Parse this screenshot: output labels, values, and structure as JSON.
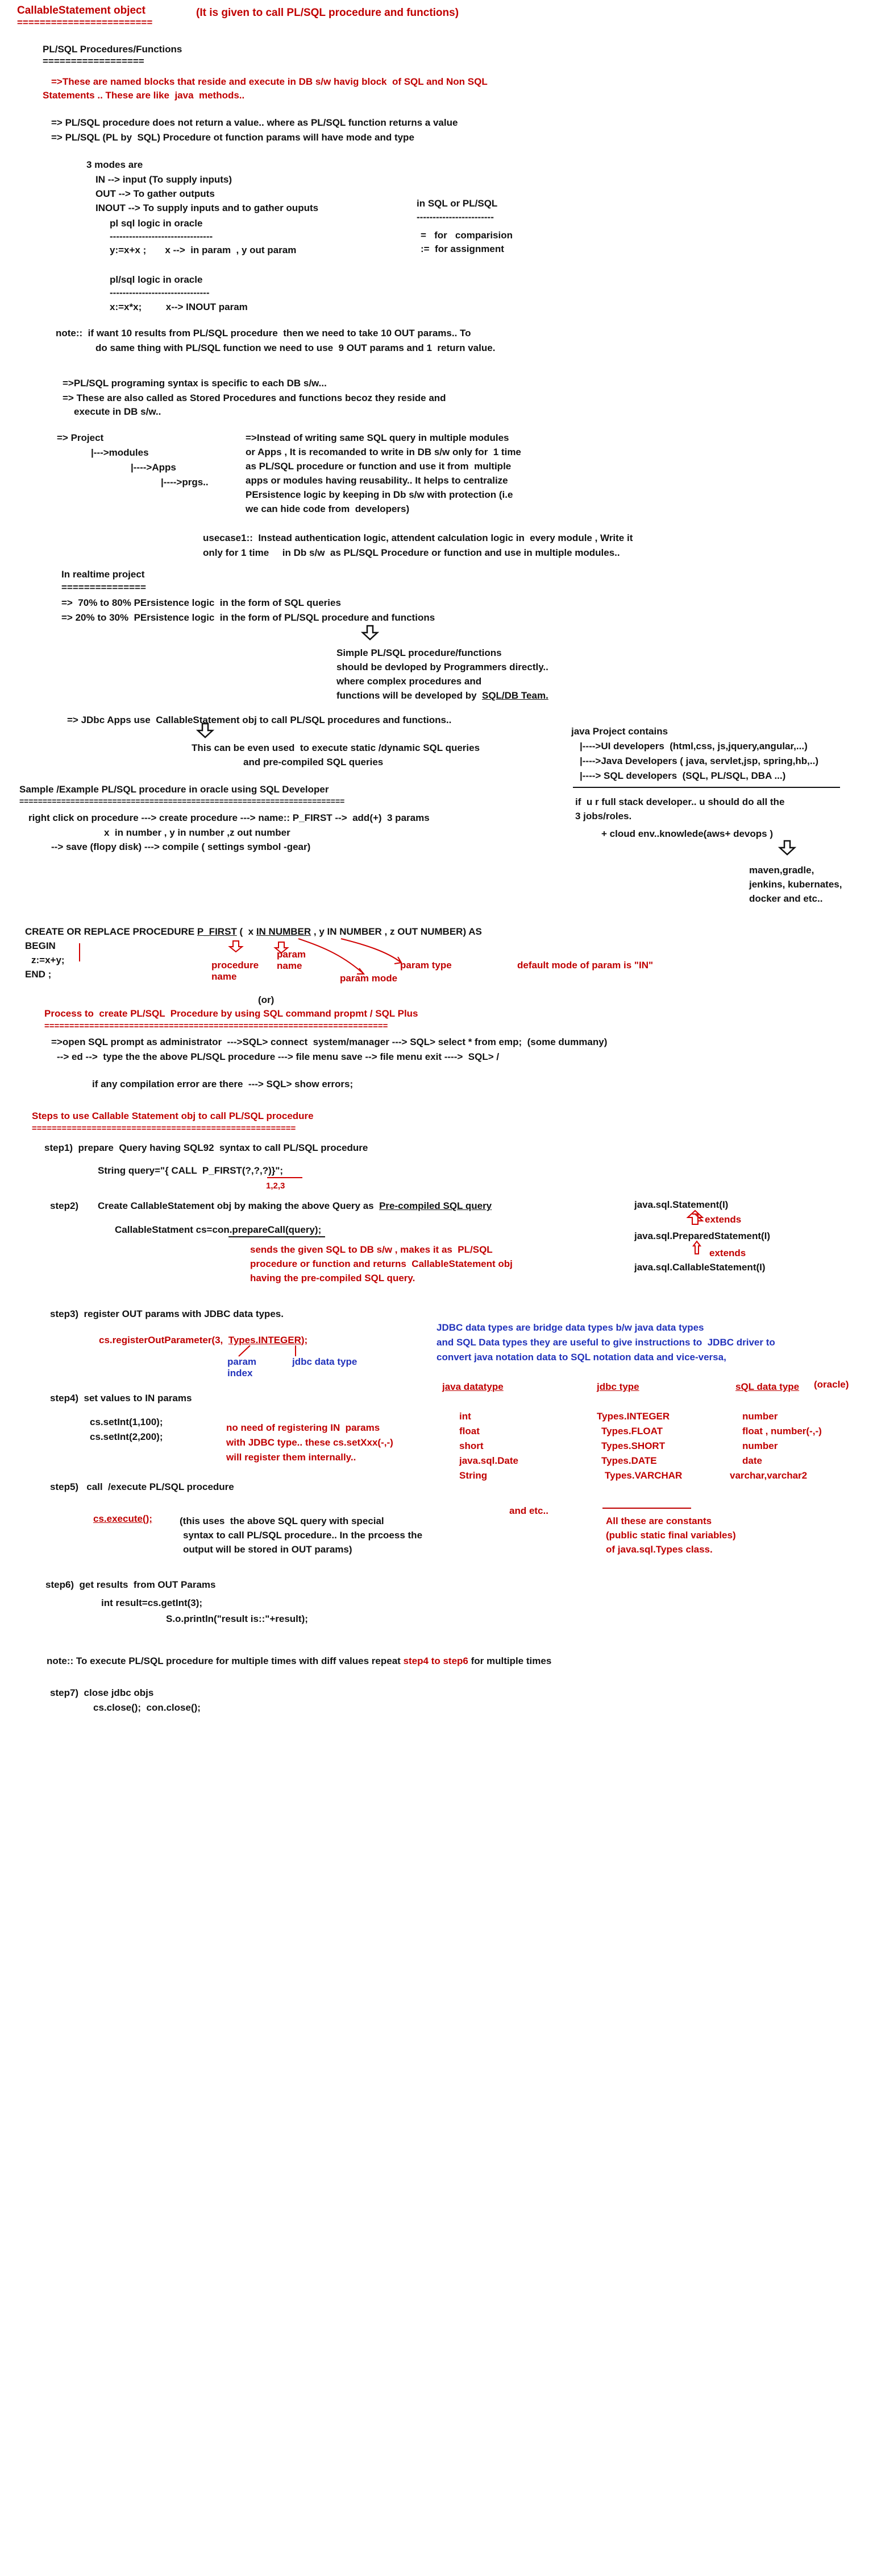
{
  "header": {
    "title": "CallableStatement object",
    "title_underline": "========================",
    "note": "(It is given to call PL/SQL procedure and functions)"
  },
  "intro": {
    "heading": "PL/SQL Procedures/Functions",
    "heading_underline": "==================",
    "red1": "=>These are named blocks that reside and execute in DB s/w havig block  of SQL and Non SQL",
    "red2": "Statements .. These are like  java  methods..",
    "p1": "=> PL/SQL procedure does not return a value.. where as PL/SQL function returns a value",
    "p2": "=> PL/SQL (PL by  SQL) Procedure ot function params will have mode and type",
    "modes": "3 modes are",
    "in": "IN --> input (To supply inputs)",
    "out": "OUT --> To gather outputs",
    "inout": "INOUT --> To supply inputs and to gather ouputs",
    "logic1": "pl sql logic in oracle",
    "dash1": "--------------------------------",
    "eq1": "y:=x+x ;       x -->  in param  , y out param",
    "logic2": "pl/sql logic in oracle",
    "dash2": "-------------------------------",
    "eq2": "x:=x*x;         x--> INOUT param",
    "insql": "in SQL or PL/SQL",
    "dash3": "------------------------",
    "eqc": "=   for   comparision",
    "assign": ":=  for assignment"
  },
  "note1": {
    "l1": "note::  if want 10 results from PL/SQL procedure  then we need to take 10 OUT params.. To",
    "l2": "do same thing with PL/SQL function we need to use  9 OUT params and 1  return value."
  },
  "syntax": {
    "l1": "=>PL/SQL programing syntax is specific to each DB s/w...",
    "l2": "=> These are also called as Stored Procedures and functions becoz they reside and",
    "l3": "execute in DB s/w.."
  },
  "project": {
    "p": "=> Project",
    "m": "|--->modules",
    "a": "|---->Apps",
    "pr": "|---->prgs..",
    "r1": "=>Instead of writing same SQL query in multiple modules",
    "r2": "or Apps , It is recomanded to write in DB s/w only for  1 time",
    "r3": "as PL/SQL procedure or function and use it from  multiple",
    "r4": "apps or modules having reusability.. It helps to centralize",
    "r5": "PErsistence logic by keeping in Db s/w with protection (i.e",
    "r6": "we can hide code from  developers)",
    "u1": "usecase1::  Instead authentication logic, attendent calculation logic in  every module , Write it",
    "u2": "only for 1 time     in Db s/w  as PL/SQL Procedure or function and use in multiple modules.."
  },
  "realtime": {
    "h": "In realtime project",
    "hu": "===============",
    "l1": "=>  70% to 80% PErsistence logic  in the form of SQL queries",
    "l2": "=> 20% to 30%  PErsistence logic  in the form of PL/SQL procedure and functions",
    "s1": "Simple PL/SQL procedure/functions",
    "s2": "should be devloped by Programmers directly..",
    "s3": "where complex procedures and",
    "s4": "functions will be developed by  ",
    "s4u": "SQL/DB Team.",
    "jdbc": "=> JDbc Apps use  CallableStatement obj to call PL/SQL procedures and functions..",
    "c1": "This can be even used  to execute static /dynamic SQL queries",
    "c2": "and pre-compiled SQL queries"
  },
  "javaproj": {
    "h": "java Project contains",
    "l1": "|---->UI developers  (html,css, js,jquery,angular,...)",
    "l2": "|---->Java Developers ( java, servlet,jsp, spring,hb,..)",
    "l3": "|----> SQL developers  (SQL, PL/SQL, DBA ...)",
    "f1": "if  u r full stack developer.. u should do all the",
    "f2": "3 jobs/roles.",
    "f3": "+ cloud env..knowlede(aws+ devops )",
    "m1": "maven,gradle,",
    "m2": "jenkins, kubernates,",
    "m3": "docker and etc.."
  },
  "sample": {
    "h": "Sample /Example PL/SQL procedure in oracle using SQL Developer",
    "hu": "======================================================================",
    "l1": "right click on procedure ---> create procedure ---> name:: P_FIRST -->  add(+)  3 params",
    "l2": "x  in number , y in number ,z out number",
    "l3": "--> save (flopy disk) ---> compile ( settings symbol -gear)"
  },
  "code": {
    "l1a": "CREATE OR REPLACE PROCEDURE ",
    "l1b": "P_FIRST",
    "l1c": " (  x ",
    "l1d": "IN NUMBER",
    "l1e": " , y IN NUMBER , z OUT NUMBER) AS",
    "l2": "BEGIN",
    "l3": "z:=x+y;",
    "l4": "END ;",
    "a_proc": "procedure\nname",
    "a_pname": "param\nname",
    "a_ptype": "param type",
    "a_pmode": "param mode",
    "a_default": "default mode of param is \"IN\""
  },
  "plus": {
    "or": "(or)",
    "h": "Process to  create PL/SQL  Procedure by using SQL command propmt / SQL Plus",
    "hu": "=====================================================================",
    "l1": "=>open SQL prompt as administrator  --->SQL> connect  system/manager ---> SQL> select * from emp;  (some dummany)",
    "l2": "--> ed -->  type the the above PL/SQL procedure ---> file menu save --> file menu exit ---->  SQL> /",
    "l3": "if any compilation error are there  ---> SQL> show errors;"
  },
  "steps": {
    "h": "Steps to use Callable Statement obj to call PL/SQL procedure",
    "hu": "=====================================================",
    "s1": "step1)  prepare  Query having SQL92  syntax to call PL/SQL procedure",
    "s1c": "String query=\"{ CALL  P_FIRST(?,?,?)}\";",
    "s1n": "1,2,3",
    "s2": "step2)",
    "s2t": "Create CallableStatement obj by making the above Query as  ",
    "s2u": "Pre-compiled SQL query",
    "s2c": "CallableStatment cs=con.prepareCall(query);",
    "s2r1": "sends the given SQL to DB s/w , makes it as  PL/SQL",
    "s2r2": "procedure or function and returns  CallableStatement obj",
    "s2r3": "having the pre-compiled SQL query.",
    "i1": "java.sql.Statement(I)",
    "ext1": "extends",
    "i2": "java.sql.PreparedStatement(I)",
    "ext2": "extends",
    "i3": "java.sql.CallableStatement(I)",
    "s3": "step3)  register OUT params with JDBC data types.",
    "s3c1": "cs.registerOutParameter(3,  ",
    "s3c2": "Types.INTEGER",
    "s3c3": ");",
    "pidx": "param\nindex",
    "jdt": "jdbc data type",
    "b1": "JDBC data types are bridge data types b/w java data types",
    "b2": "and SQL Data types they are useful to give instructions to  JDBC driver to",
    "b3": "convert java notation data to SQL notation data and vice-versa,",
    "s4": "step4)  set values to IN params",
    "s4a": "cs.setInt(1,100);",
    "s4b": "cs.setInt(2,200);",
    "s4r1": "no need of registering IN  params",
    "s4r2": "with JDBC type.. these cs.setXxx(-,-)",
    "s4r3": "will register them internally..",
    "s5": "step5)   call  /execute PL/SQL procedure",
    "s5c": "cs.execute();",
    "s5t1": "(this uses  the above SQL query with special",
    "s5t2": "syntax to call PL/SQL procedure.. In the prcoess the",
    "s5t3": "output will be stored in OUT params)",
    "etc": "and etc..",
    "const1": "All these are constants",
    "const2": "(public static final variables)",
    "const3": "of java.sql.Types class.",
    "s6": "step6)  get results  from OUT Params",
    "s6a": "int result=cs.getInt(3);",
    "s6b": "S.o.println(\"result is::\"+result);",
    "note_a": "note:: To execute PL/SQL procedure for multiple times with diff values repeat ",
    "note_b": "step4 to step6",
    "note_c": " for multiple times",
    "s7": "step7)  close jdbc objs",
    "s7a": "cs.close();  con.close();"
  },
  "table": {
    "headers": [
      "java datatype",
      "jdbc type",
      "sQL data type"
    ],
    "oracle": "(oracle)",
    "rows": [
      [
        "int",
        "Types.INTEGER",
        "number"
      ],
      [
        "float",
        "Types.FLOAT",
        "float , number(-,-)"
      ],
      [
        "short",
        "Types.SHORT",
        "number"
      ],
      [
        "java.sql.Date",
        "Types.DATE",
        "date"
      ],
      [
        "String",
        "Types.VARCHAR",
        "varchar,varchar2"
      ]
    ]
  }
}
